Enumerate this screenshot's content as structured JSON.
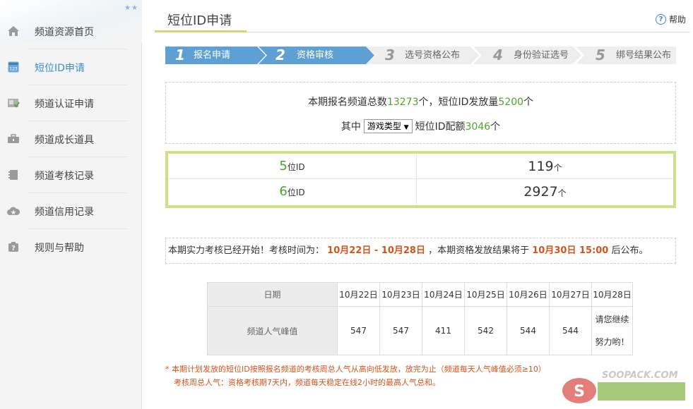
{
  "sidebar": {
    "items": [
      {
        "label": "频道资源首页",
        "icon": "home-icon"
      },
      {
        "label": "短位ID申请",
        "icon": "id-card-icon"
      },
      {
        "label": "频道认证申请",
        "icon": "certificate-icon"
      },
      {
        "label": "频道成长道具",
        "icon": "toolbox-icon"
      },
      {
        "label": "频道考核记录",
        "icon": "notebook-icon"
      },
      {
        "label": "频道信用记录",
        "icon": "cloud-star-icon"
      },
      {
        "label": "规则与帮助",
        "icon": "help-box-icon"
      }
    ],
    "active_index": 1,
    "badge_text": "123"
  },
  "header": {
    "title": "短位ID申请",
    "help_label": "帮助"
  },
  "steps": [
    {
      "num": "1",
      "label": "报名申请",
      "state": "active"
    },
    {
      "num": "2",
      "label": "资格审核",
      "state": "active"
    },
    {
      "num": "3",
      "label": "选号资格公布",
      "state": "inactive"
    },
    {
      "num": "4",
      "label": "身份验证选号",
      "state": "inactive"
    },
    {
      "num": "5",
      "label": "绑号结果公布",
      "state": "inactive"
    }
  ],
  "summary": {
    "line1_prefix": "本期报名频道总数",
    "total_channels": "13273",
    "line1_mid": "个，短位ID发放量",
    "issued": "5200",
    "line1_suffix": "个",
    "line2_prefix": "其中",
    "category_selected": "游戏类型",
    "line2_mid": "短位ID配额",
    "quota": "3046",
    "line2_suffix": "个"
  },
  "quota_table": {
    "rows": [
      {
        "digits": "5",
        "unit": "位ID",
        "count": "119",
        "count_unit": "个"
      },
      {
        "digits": "6",
        "unit": "位ID",
        "count": "2927",
        "count_unit": "个"
      }
    ]
  },
  "notice": {
    "prefix": "本期实力考核已经开始！考核时间为：",
    "period": "10月22日 - 10月28日",
    "mid": "，本期资格发放结果将于",
    "result_time": "10月30日 15:00",
    "suffix": "后公布。"
  },
  "daily_table": {
    "date_header": "日期",
    "value_header": "频道人气峰值",
    "dates": [
      "10月22日",
      "10月23日",
      "10月24日",
      "10月25日",
      "10月26日",
      "10月27日",
      "10月28日"
    ],
    "values": [
      "547",
      "547",
      "411",
      "542",
      "544",
      "544"
    ],
    "last_line1": "请您继续",
    "last_line2": "努力哟！"
  },
  "footnote": {
    "line1": "* 本期计划发放的短位ID按照报名频道的考核周总人气从高向低发放，放完为止（频道每天人气峰值必须≥10）",
    "line2": "考核周总人气：资格考核期7天内，频道每天稳定在线2小时的最高人气总和。"
  },
  "watermark": {
    "text": "SOOPACK.COM"
  },
  "colors": {
    "accent_blue": "#5fa0d4",
    "green": "#4aa62b",
    "highlight_red": "#d4541c",
    "quota_border": "#cde08a"
  }
}
